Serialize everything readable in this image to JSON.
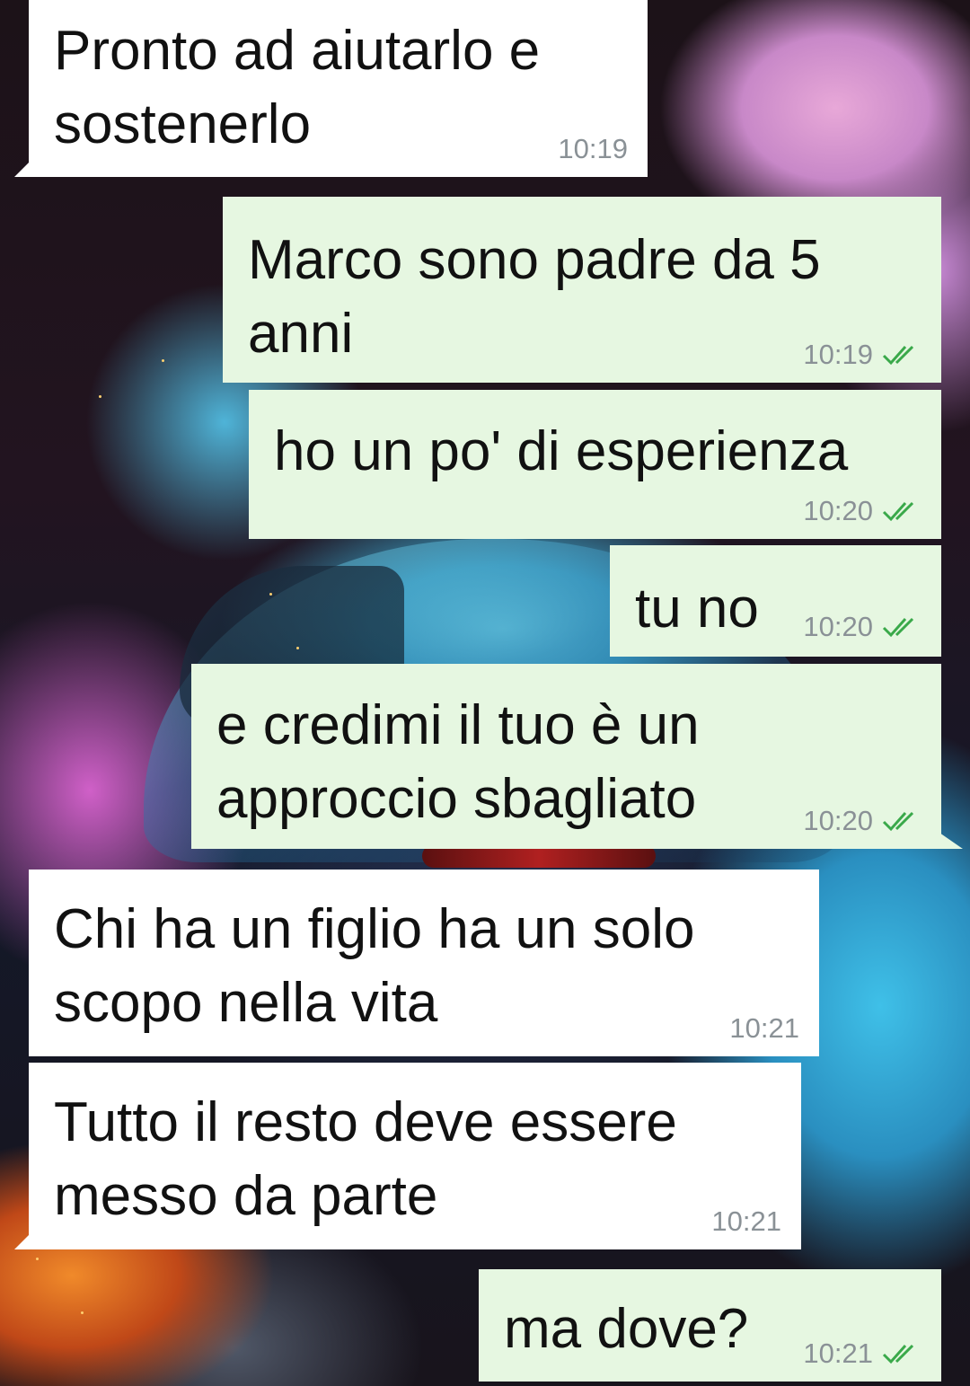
{
  "messages": [
    {
      "text": "Pronto ad aiutarlo e\nsostenerlo",
      "time": "10:19",
      "direction": "incoming"
    },
    {
      "text": "Marco sono padre da 5\nanni",
      "time": "10:19",
      "direction": "outgoing",
      "status": "read"
    },
    {
      "text": "ho un po' di esperienza",
      "time": "10:20",
      "direction": "outgoing",
      "status": "read"
    },
    {
      "text": "tu no",
      "time": "10:20",
      "direction": "outgoing",
      "status": "read"
    },
    {
      "text": "e credimi il tuo è un\napproccio sbagliato",
      "time": "10:20",
      "direction": "outgoing",
      "status": "read"
    },
    {
      "text": "Chi ha un figlio ha un solo\nscopo nella vita",
      "time": "10:21",
      "direction": "incoming"
    },
    {
      "text": "Tutto il resto deve essere\nmesso da parte",
      "time": "10:21",
      "direction": "incoming"
    },
    {
      "text": "ma dove?",
      "time": "10:21",
      "direction": "outgoing",
      "status": "read"
    }
  ],
  "colors": {
    "incoming_bubble": "#ffffff",
    "outgoing_bubble": "#e6f7e1",
    "timestamp": "#8a9196",
    "read_ticks": "#3aa94a"
  },
  "icons": {
    "read_status": "double-check-icon"
  }
}
